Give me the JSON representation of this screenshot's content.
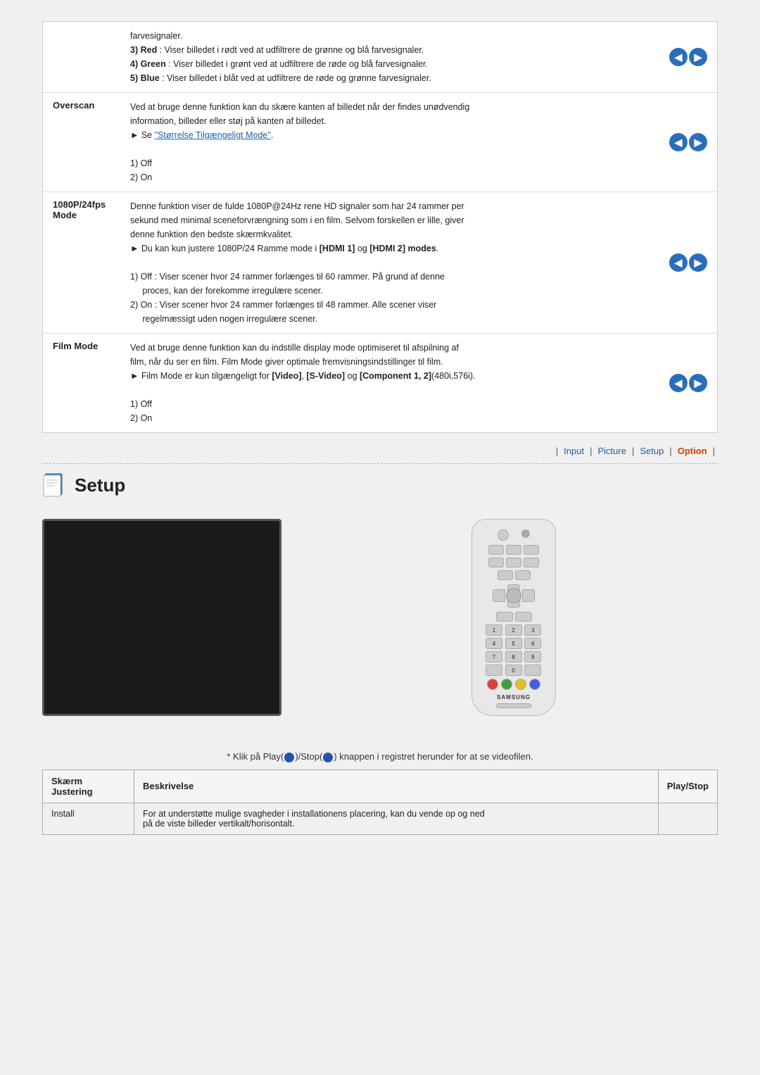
{
  "manual": {
    "rows": [
      {
        "label": "",
        "content_lines": [
          "farvesignaler.",
          "3) Red : Viser billedet i rødt ved at udfiltrere de grønne og blå farvesignaler.",
          "4) Green : Viser billedet i grønt ved at udfiltrere de røde og blå farvesignaler.",
          "5) Blue : Viser billedet i blåt ved at udfiltrere de røde og grønne farvesignaler."
        ],
        "has_icons": true
      },
      {
        "label": "Overscan",
        "content_lines": [
          "Ved at bruge denne funktion kan du skære kanten af billedet når der findes unødvendig",
          "information, billeder eller støj på kanten af billedet.",
          "▶ Se \"Størrelse Tilgængeligt Mode\".",
          "",
          "1) Off",
          "2) On"
        ],
        "has_icons": true
      },
      {
        "label": "1080P/24fps\nMode",
        "content_lines": [
          "Denne funktion viser de fulde 1080P@24Hz rene HD signaler som har 24 rammer per",
          "sekund med minimal sceneforvrængning som i en film. Selvom forskellen er lille, giver",
          "denne funktion den bedste skærmkvalitet.",
          "▶ Du kan kun justere 1080P/24 Ramme mode i [HDMI 1] og [HDMI 2] modes.",
          "",
          "1) Off : Viser scener hvor 24 rammer forlænges til 60 rammer. På grund af denne",
          "     proces, kan der forekomme irregulære scener.",
          "2) On : Viser scener hvor 24 rammer forlænges til 48 rammer. Alle scener viser",
          "     regelmæssigt uden nogen irregulære scener."
        ],
        "has_icons": true
      },
      {
        "label": "Film Mode",
        "content_lines": [
          "Ved at bruge denne funktion kan du indstille display mode optimiseret til afspilning af",
          "film, når du ser en film. Film Mode giver optimale fremvisningsindstillinger til film.",
          "▶ Film Mode er kun tilgængeligt for [Video], [S-Video] og [Component 1, 2](480i,576i).",
          "",
          "1) Off",
          "2) On"
        ],
        "has_icons": true
      }
    ]
  },
  "nav": {
    "separator": "|",
    "items": [
      {
        "label": "Input",
        "active": false
      },
      {
        "label": "Picture",
        "active": false
      },
      {
        "label": "Setup",
        "active": false
      },
      {
        "label": "Option",
        "active": true
      }
    ]
  },
  "setup": {
    "title": "Setup",
    "icon_alt": "setup-icon"
  },
  "bottom": {
    "play_note": "* Klik på Play(",
    "play_note_mid": ")/Stop(",
    "play_note_end": ") knappen i registret herunder for at se videofilen.",
    "table_headers": {
      "col1": "Skærm Justering",
      "col2": "Beskrivelse",
      "col3": "Play/Stop"
    },
    "table_rows": [
      {
        "col1": "Install",
        "col2": "For at understøtte mulige svagheder i installationens placering, kan du vende op og ned\npå de viste billeder vertikalt/horisontalt.",
        "col3": ""
      }
    ]
  }
}
